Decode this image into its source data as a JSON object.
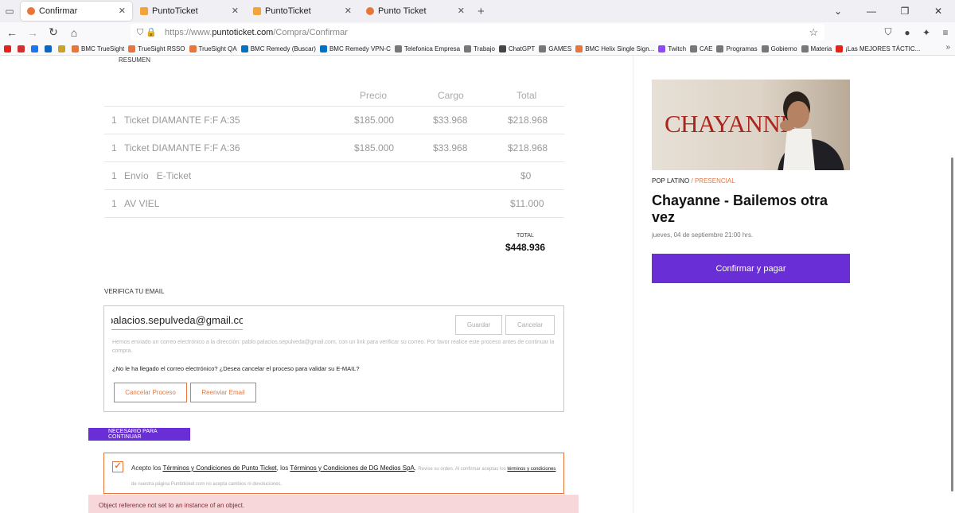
{
  "tabs": [
    {
      "title": "Confirmar",
      "active": true
    },
    {
      "title": "PuntoTicket",
      "active": false
    },
    {
      "title": "PuntoTicket",
      "active": false
    },
    {
      "title": "Punto Ticket",
      "active": false
    }
  ],
  "url": {
    "prefix": "https://www.",
    "domain": "puntoticket.com",
    "path": "/Compra/Confirmar"
  },
  "bookmarks": [
    {
      "label": "",
      "color": "#e62117"
    },
    {
      "label": "",
      "color": "#d62e2e"
    },
    {
      "label": "",
      "color": "#1877f2"
    },
    {
      "label": "",
      "color": "#0a66c2"
    },
    {
      "label": "",
      "color": "#c9a227"
    },
    {
      "label": "BMC TrueSight",
      "color": "#e8763b"
    },
    {
      "label": "TrueSight RSSO",
      "color": "#e8763b"
    },
    {
      "label": "TrueSight QA",
      "color": "#e8763b"
    },
    {
      "label": "BMC Remedy (Buscar)",
      "color": "#0072c6"
    },
    {
      "label": "BMC Remedy VPN-C",
      "color": "#0072c6"
    },
    {
      "label": "Telefonica Empresa",
      "color": "#777"
    },
    {
      "label": "Trabajo",
      "color": "#777"
    },
    {
      "label": "ChatGPT",
      "color": "#444"
    },
    {
      "label": "GAMES",
      "color": "#777"
    },
    {
      "label": "BMC Helix Single Sign...",
      "color": "#e8763b"
    },
    {
      "label": "Twitch",
      "color": "#9146ff"
    },
    {
      "label": "CAE",
      "color": "#777"
    },
    {
      "label": "Programas",
      "color": "#777"
    },
    {
      "label": "Gobierno",
      "color": "#777"
    },
    {
      "label": "Materia",
      "color": "#777"
    },
    {
      "label": "¡Las MEJORES TÁCTIC...",
      "color": "#e62117"
    }
  ],
  "summary": {
    "title": "RESUMEN",
    "headers": {
      "price": "Precio",
      "charge": "Cargo",
      "total": "Total"
    },
    "rows": [
      {
        "qty": "1",
        "desc": "Ticket DIAMANTE F:F A:35",
        "price": "$185.000",
        "charge": "$33.968",
        "total": "$218.968"
      },
      {
        "qty": "1",
        "desc": "Ticket DIAMANTE F:F A:36",
        "price": "$185.000",
        "charge": "$33.968",
        "total": "$218.968"
      },
      {
        "qty": "1",
        "desc": "Envío   E-Ticket",
        "price": "",
        "charge": "",
        "total": "$0"
      },
      {
        "qty": "1",
        "desc": "AV VIEL",
        "price": "",
        "charge": "",
        "total": "$11.000"
      }
    ],
    "total_label": "TOTAL",
    "total_value": "$448.936"
  },
  "verify": {
    "title": "VERIFICA TU EMAIL",
    "email_value": "palacios.sepulveda@gmail.com",
    "save_label": "Guardar",
    "cancel_label": "Cancelar",
    "note": "Hemos enviado un correo electrónico a la dirección: pablo.palacios.sepulveda@gmail.com, con un link para verificar su correo. Por favor realice este proceso antes de continuar la compra.",
    "question": "¿No le ha llegado el correo electrónico? ¿Desea cancelar el proceso para validar su E-MAIL?",
    "cancel_process_label": "Cancelar Proceso",
    "resend_label": "Reenviar Email"
  },
  "required": {
    "label": "NECESARIO PARA CONTINUAR"
  },
  "terms": {
    "t1": "Acepto los ",
    "link1": "Términos y Condiciones de Punto Ticket",
    "t2": ", los ",
    "link2": "Términos y Condiciones de DG Medios SpA",
    "t3": ". ",
    "small1": "Revise su orden. Al confirmar aceptas los ",
    "link3": "términos y condiciones",
    "small2": " de nuestra página Puntoticket.com no acepta cambios ni devoluciones."
  },
  "error": "Object reference not set to an instance of an object.",
  "event": {
    "banner_name": "CHAYANNE",
    "genre": "POP LATINO",
    "mode": "PRESENCIAL",
    "title": "Chayanne - Bailemos otra vez",
    "date": "jueves, 04 de septiembre 21:00 hrs.",
    "pay_label": "Confirmar y pagar"
  },
  "colors": {
    "accent": "#6a2ed6",
    "orange": "#e8763b",
    "error_bg": "#f7d7da"
  }
}
